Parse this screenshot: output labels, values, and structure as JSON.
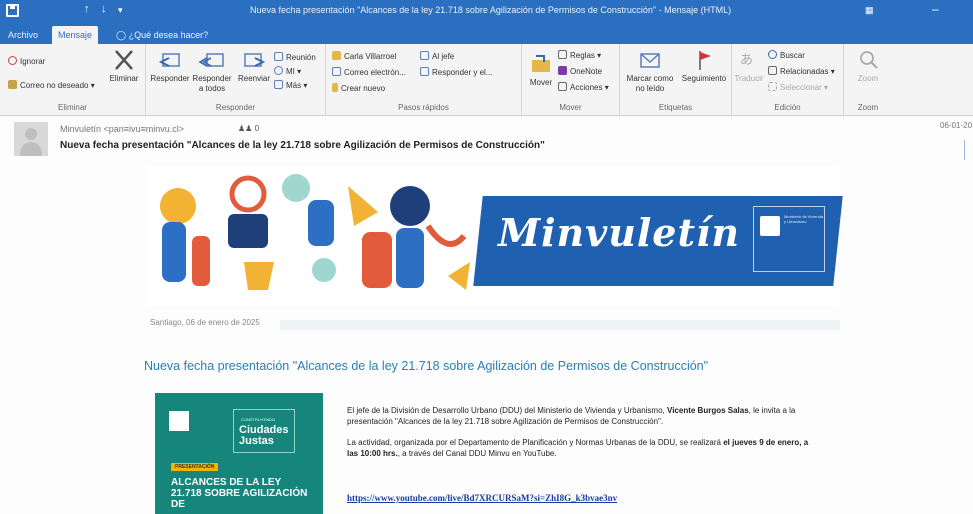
{
  "titlebar": {
    "title": "Nueva fecha presentación \"Alcances de la ley 21.718 sobre Agilización de Permisos de Construcción\" - Mensaje (HTML)"
  },
  "tabs": [
    {
      "label": "Archivo"
    },
    {
      "label": "Mensaje"
    },
    {
      "label": "¿Qué desea hacer?"
    }
  ],
  "ribbon": {
    "eliminar": {
      "ignorar": "Ignorar",
      "correo_no_deseado": "Correo no deseado",
      "eliminar": "Eliminar",
      "label": "Eliminar"
    },
    "responder": {
      "responder": "Responder",
      "responder_a_todos": "Responder a todos",
      "reenviar": "Reenviar",
      "reunion": "Reunión",
      "mi": "MI",
      "mas": "Más",
      "label": "Responder"
    },
    "pasos_rapidos": {
      "items": [
        "Carla Villarroel",
        "Correo electrón...",
        "Crear nuevo",
        "Al jefe",
        "Responder y el..."
      ],
      "label": "Pasos rápidos"
    },
    "mover": {
      "mover": "Mover",
      "reglas": "Reglas",
      "onenote": "OneNote",
      "acciones": "Acciones",
      "label": "Mover"
    },
    "etiquetas": {
      "marcar_como_no_leido": "Marcar como no leído",
      "seguimiento": "Seguimiento",
      "label": "Etiquetas"
    },
    "edicion": {
      "traducir": "Traducir",
      "buscar": "Buscar",
      "relacionadas": "Relacionadas",
      "seleccionar": "Seleccionar",
      "label": "Edición"
    },
    "zoom": {
      "zoom": "Zoom",
      "label": "Zoom"
    }
  },
  "message": {
    "sender": "Minvuletín <pan≡ivu≡minvu.cl>",
    "people_icon_text": "0",
    "subject": "Nueva fecha presentación \"Alcances de la ley 21.718 sobre Agilización de Permisos de Construcción\"",
    "date": "06-01-20"
  },
  "banner": {
    "wordmark": "Minvuletín",
    "gov_text": "Ministerio de Vivienda y Urbanismo"
  },
  "place_date": "Santiago, 06 de enero de 2025",
  "headline": "Nueva fecha presentación \"Alcances de la ley 21.718 sobre Agilización de Permisos de Construcción\"",
  "poster": {
    "top_text": "CONSTRUYENDO",
    "city_line1": "Ciudades",
    "city_line2": "Justas",
    "tag": "PRESENTACIÓN",
    "title": "ALCANCES DE LA LEY 21.718 SOBRE AGILIZACIÓN DE"
  },
  "body": {
    "p1_pre": "El jefe de la División de Desarrollo Urbano (DDU) del Ministerio de Vivienda y Urbanismo, ",
    "p1_bold": "Vicente Burgos Salas",
    "p1_post": ", le invita a la presentación \"Alcances de la ley 21.718 sobre Agilización de Permisos de Construcción\".",
    "p2_pre": "La actividad, organizada por el Departamento de Planificación y Normas Urbanas de la DDU, se realizará ",
    "p2_bold": "el jueves 9 de enero, a las 10:00 hrs.",
    "p2_post": ", a través del Canal DDU Minvu en YouTube.",
    "link": "https://www.youtube.com/live/Bd7XRCURSaM?si=ZhI8G_k3bvae3nv"
  },
  "colors": {
    "office_blue": "#2b6fc1",
    "minvu_blue": "#1f61b0",
    "headline_blue": "#2a7fb3",
    "poster_teal": "#16857c"
  }
}
